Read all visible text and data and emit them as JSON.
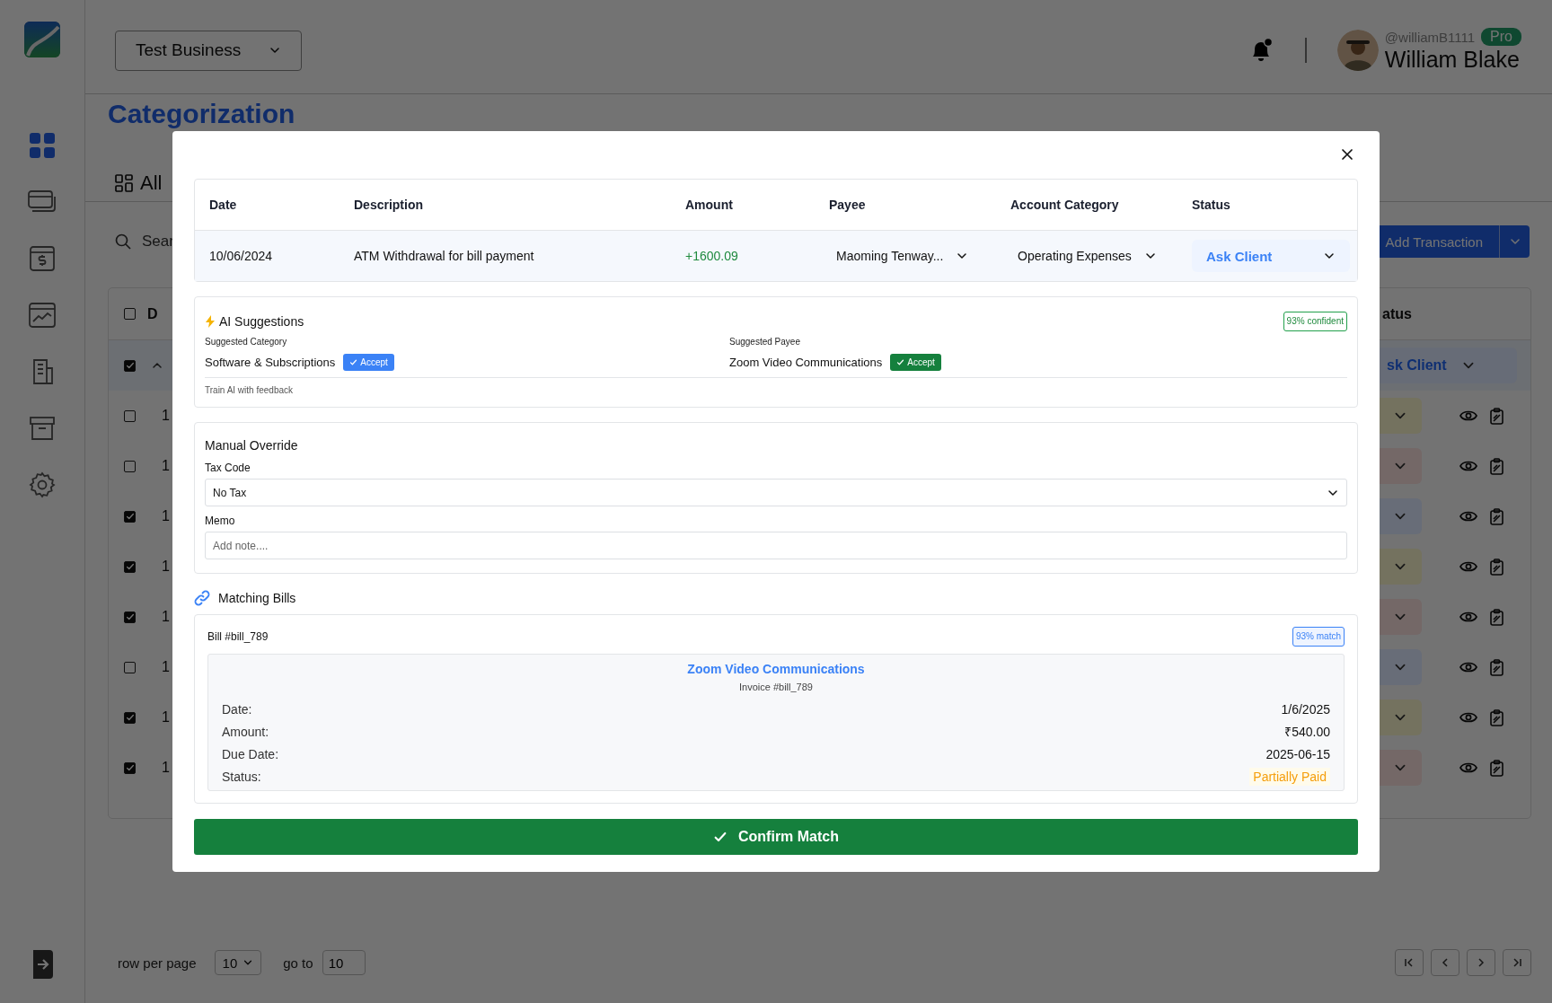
{
  "sidebar": {
    "items": [
      {
        "selected": true
      },
      {
        "selected": false
      },
      {
        "selected": false
      },
      {
        "selected": false
      },
      {
        "selected": false
      },
      {
        "selected": false
      },
      {
        "selected": false
      }
    ]
  },
  "header": {
    "business": "Test Business",
    "unread": true,
    "username": "@williamB1111",
    "plan": "Pro",
    "name": "William Blake"
  },
  "page": {
    "title": "Categorization",
    "tab": "All",
    "search_placeholder": "Sear",
    "add_button": "Add Transaction"
  },
  "table": {
    "header_checked": false,
    "first_column": "D",
    "status_column": "atus",
    "rows": [
      {
        "checked": true,
        "expanded": true,
        "status": "sk Client",
        "color": "#676c77"
      },
      {
        "checked": false,
        "date": "1",
        "color": "#74725f"
      },
      {
        "checked": false,
        "date": "1",
        "color": "#746867"
      },
      {
        "checked": true,
        "date": "1",
        "color": "#686d78"
      },
      {
        "checked": true,
        "date": "1",
        "color": "#74725f"
      },
      {
        "checked": true,
        "date": "1",
        "color": "#746867"
      },
      {
        "checked": false,
        "date": "1",
        "color": "#686d78"
      },
      {
        "checked": true,
        "date": "1",
        "color": "#74725f"
      },
      {
        "checked": true,
        "date": "1",
        "color": "#746867"
      }
    ]
  },
  "pagination": {
    "rows_label": "row per page",
    "page_size": "10",
    "goto_label": "go to",
    "goto_value": "10"
  },
  "modal": {
    "transaction": {
      "columns": [
        "Date",
        "Description",
        "Amount",
        "Payee",
        "Account Category",
        "Status"
      ],
      "row": {
        "date": "10/06/2024",
        "description": "ATM Withdrawal for bill payment",
        "amount": "+1600.09",
        "payee": "Maoming Tenway...",
        "category": "Operating Expenses",
        "status": "Ask Client"
      }
    },
    "ai": {
      "title": "AI Suggestions",
      "confidence": "93% confident",
      "suggestions": [
        {
          "label": "Suggested Category",
          "value": "Software & Subscriptions",
          "button": "Accept",
          "color": "#3b82f6"
        },
        {
          "label": "Suggested Payee",
          "value": "Zoom Video Communications",
          "button": "Accept",
          "color": "#15803d"
        }
      ],
      "feedback": "Train AI with feedback"
    },
    "manual": {
      "title": "Manual Override",
      "fields": [
        {
          "kind": "select",
          "label": "Tax Code",
          "value": "No Tax"
        },
        {
          "kind": "input",
          "label": "Memo",
          "placeholder": "Add note...."
        }
      ]
    },
    "matching": {
      "title": "Matching Bills",
      "bills": [
        {
          "title": "Bill #bill_789",
          "match": "93% match",
          "vendor": "Zoom Video Communications",
          "invoice": "Invoice #bill_789",
          "details": [
            {
              "kind": "text",
              "label": "Date:",
              "value": "1/6/2025"
            },
            {
              "kind": "text",
              "label": "Amount:",
              "value": "₹540.00"
            },
            {
              "kind": "text",
              "label": "Due Date:",
              "value": "2025-06-15"
            },
            {
              "kind": "status",
              "label": "Status:",
              "value": "Partially Paid"
            }
          ]
        }
      ]
    },
    "confirm": "Confirm Match"
  }
}
